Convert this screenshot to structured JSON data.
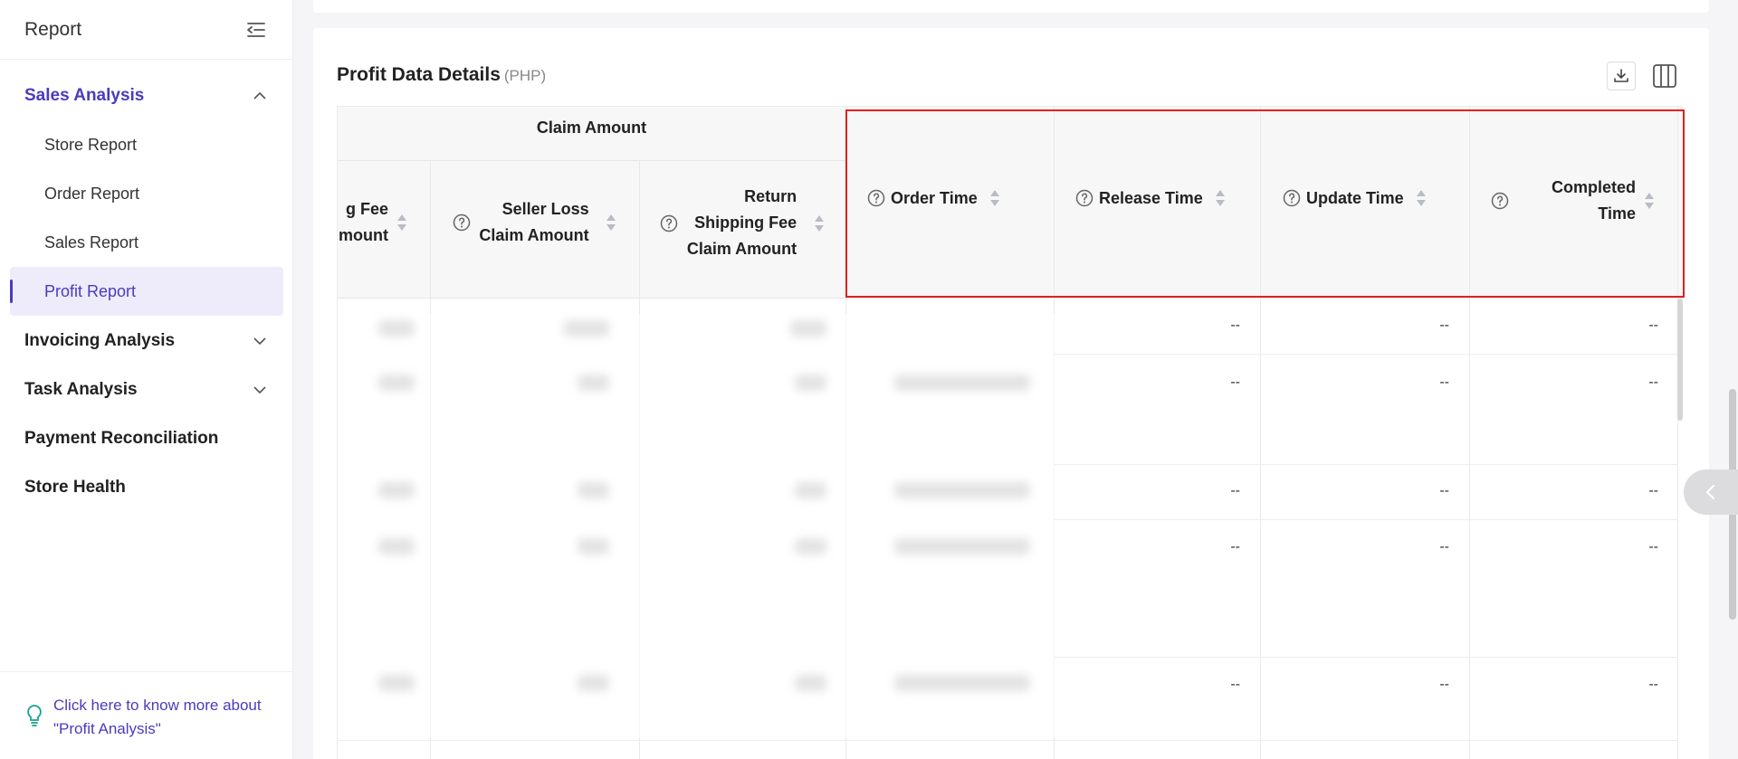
{
  "sidebar": {
    "title": "Report",
    "groups": [
      {
        "label": "Sales Analysis",
        "expanded": true
      },
      {
        "label": "Invoicing Analysis",
        "expanded": false
      },
      {
        "label": "Task Analysis",
        "expanded": false
      },
      {
        "label": "Payment Reconciliation"
      },
      {
        "label": "Store Health"
      }
    ],
    "sales_items": [
      "Store Report",
      "Order Report",
      "Sales Report",
      "Profit Report"
    ],
    "active_item": "Profit Report",
    "footer_link": "Click here to know more about \"Profit Analysis\""
  },
  "card": {
    "title": "Profit Data Details",
    "currency": "(PHP)"
  },
  "table": {
    "group_header": "Claim Amount",
    "columns": [
      {
        "label": "g Fee\nmount",
        "has_help": false
      },
      {
        "label": "Seller Loss\nClaim Amount",
        "has_help": true
      },
      {
        "label": "Return\nShipping Fee\nClaim Amount",
        "has_help": true
      },
      {
        "label": "Order Time",
        "has_help": true
      },
      {
        "label": "Release Time",
        "has_help": true
      },
      {
        "label": "Update Time",
        "has_help": true
      },
      {
        "label": "Completed\nTime",
        "has_help": true
      }
    ],
    "empty_value": "--",
    "rows": [
      {
        "release": "--",
        "update": "--",
        "completed": "--"
      },
      {
        "release": "--",
        "update": "--",
        "completed": "--"
      },
      {
        "release": "--",
        "update": "--",
        "completed": "--"
      },
      {
        "release": "--",
        "update": "--",
        "completed": "--"
      },
      {
        "release": "--",
        "update": "--",
        "completed": "--"
      }
    ]
  },
  "colors": {
    "accent": "#4a3bbf",
    "highlight": "#e02020",
    "footer_bulb": "#1aa38c"
  }
}
